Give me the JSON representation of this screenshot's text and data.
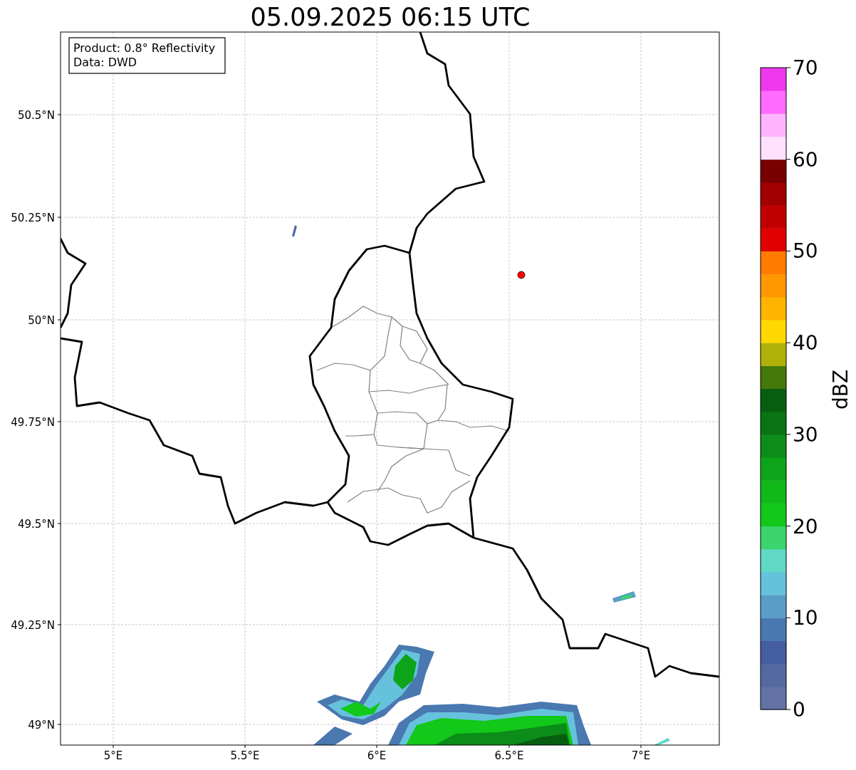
{
  "title": "05.09.2025 06:15 UTC",
  "info": [
    "Product: 0.8° Reflectivity",
    "Data: DWD"
  ],
  "map": {
    "x_ticks": [
      "5°E",
      "5.5°E",
      "6°E",
      "6.5°E",
      "7°E"
    ],
    "y_ticks": [
      "50.5°N",
      "50.25°N",
      "50°N",
      "49.75°N",
      "49.5°N",
      "49.25°N",
      "49°N"
    ]
  },
  "colorbar": {
    "label": "dBZ",
    "ticks": [
      "70",
      "60",
      "50",
      "40",
      "30",
      "20",
      "10",
      "0"
    ],
    "segments": [
      {
        "color": "#6272a4"
      },
      {
        "color": "#53699f"
      },
      {
        "color": "#445ea0"
      },
      {
        "color": "#4a78b0"
      },
      {
        "color": "#5a9ec8"
      },
      {
        "color": "#66c2dc"
      },
      {
        "color": "#5fd8c6"
      },
      {
        "color": "#3cd46c"
      },
      {
        "color": "#12c818"
      },
      {
        "color": "#10b818"
      },
      {
        "color": "#0ea41a"
      },
      {
        "color": "#0c8c18"
      },
      {
        "color": "#0a7414"
      },
      {
        "color": "#085e10"
      },
      {
        "color": "#46780c"
      },
      {
        "color": "#b0b008"
      },
      {
        "color": "#ffd800"
      },
      {
        "color": "#ffb400"
      },
      {
        "color": "#ff9800"
      },
      {
        "color": "#ff7c00"
      },
      {
        "color": "#e00000"
      },
      {
        "color": "#c00000"
      },
      {
        "color": "#a00000"
      },
      {
        "color": "#780000"
      },
      {
        "color": "#ffe0ff"
      },
      {
        "color": "#ffb4ff"
      },
      {
        "color": "#ff6cff"
      },
      {
        "color": "#ee38ee"
      }
    ]
  }
}
